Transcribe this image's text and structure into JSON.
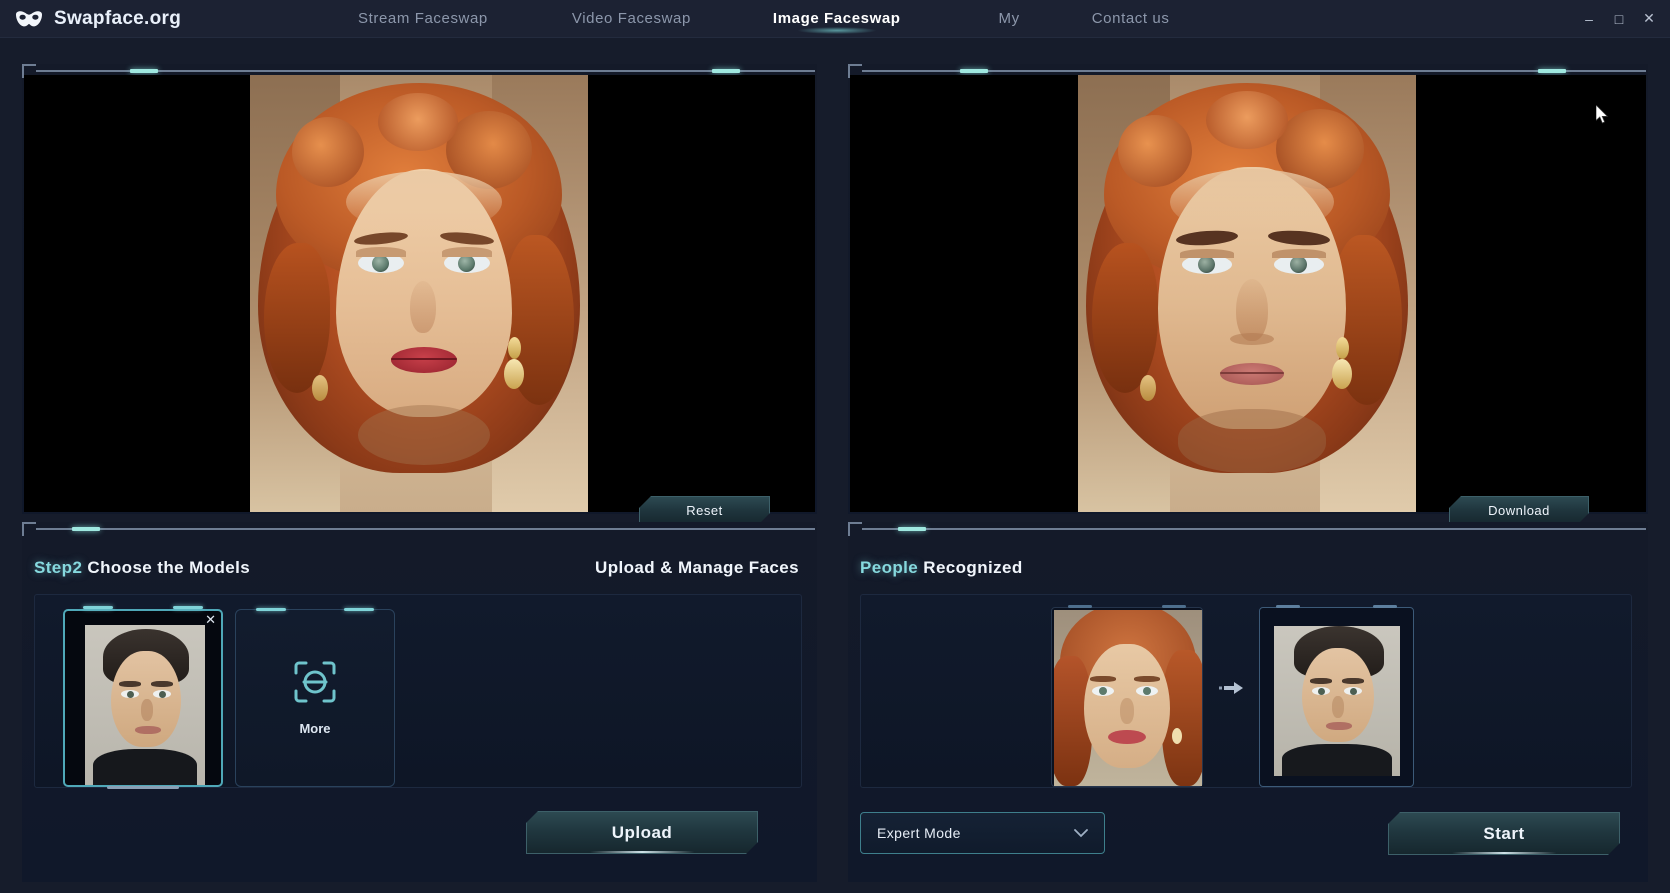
{
  "app": {
    "brand": "Swapface.org",
    "logo_icon": "mask-icon"
  },
  "nav": {
    "items": [
      {
        "label": "Stream Faceswap",
        "active": false
      },
      {
        "label": "Video Faceswap",
        "active": false
      },
      {
        "label": "Image Faceswap",
        "active": true
      },
      {
        "label": "My",
        "active": false
      },
      {
        "label": "Contact us",
        "active": false
      }
    ]
  },
  "window_controls": {
    "minimize": "–",
    "maximize": "□",
    "close": "✕"
  },
  "left_preview": {
    "reset_label": "Reset"
  },
  "right_preview": {
    "download_label": "Download"
  },
  "models_section": {
    "step_label": "Step2",
    "title": "Choose the Models",
    "manage_label": "Upload & Manage Faces",
    "selected_card": {
      "remove_icon": "close-icon",
      "subject": "male-portrait"
    },
    "more_card": {
      "label": "More",
      "icon": "face-scan-icon"
    },
    "upload_label": "Upload"
  },
  "people_section": {
    "accent_label": "People",
    "title": "Recognized",
    "pair": {
      "source": "female-portrait",
      "arrow_icon": "arrow-right-icon",
      "target": "male-portrait"
    },
    "mode_dropdown": {
      "value": "Expert Mode",
      "chevron_icon": "chevron-down-icon"
    },
    "start_label": "Start"
  },
  "colors": {
    "accent": "#86d9de",
    "panel_bg": "#121a2a",
    "titlebar_bg": "#1c2233",
    "button_border": "#3d6069"
  }
}
